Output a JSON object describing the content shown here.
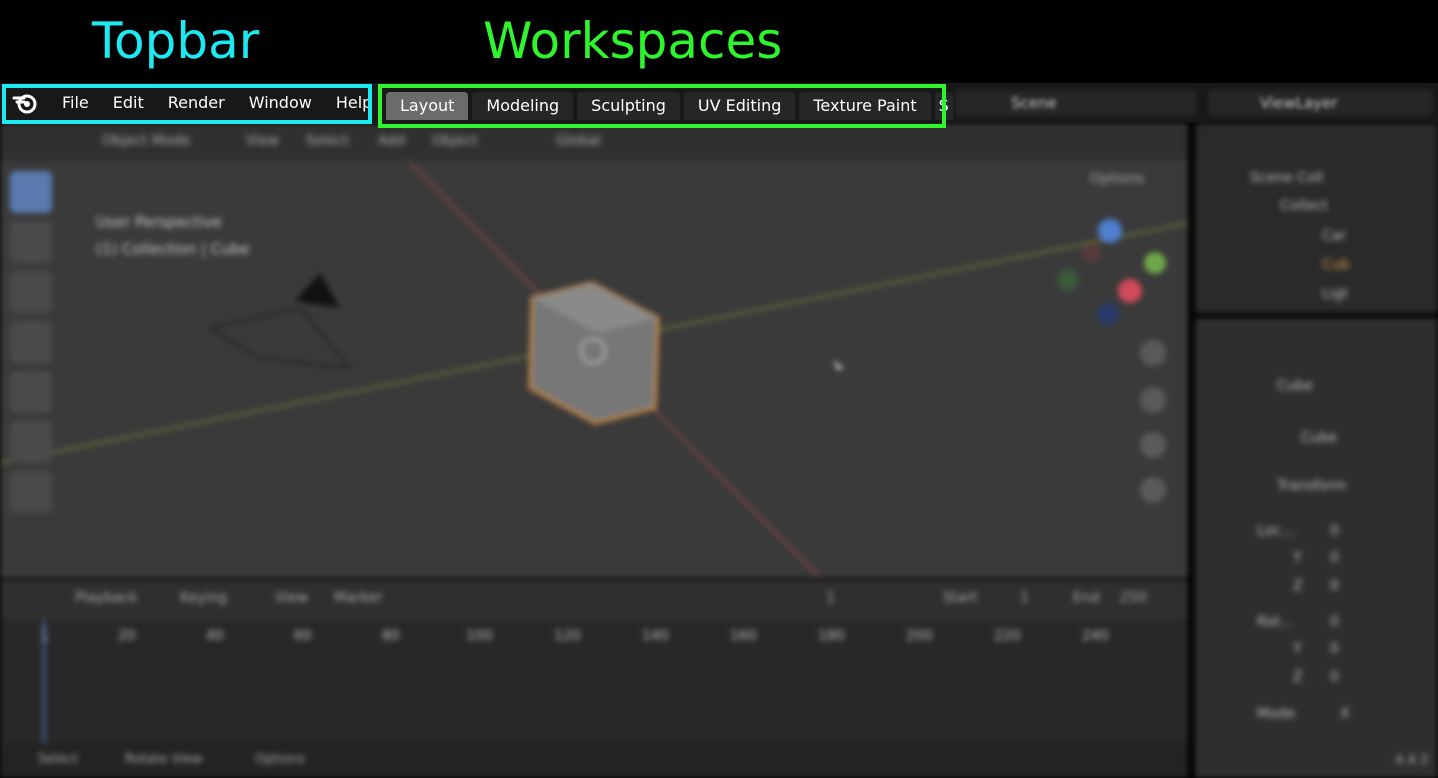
{
  "annotations": {
    "topbar_label": "Topbar",
    "workspaces_label": "Workspaces",
    "topbar_color": "#1de9f2",
    "workspaces_color": "#2ef52e"
  },
  "topbar": {
    "menu": [
      "File",
      "Edit",
      "Render",
      "Window",
      "Help"
    ],
    "workspace_tabs": [
      "Layout",
      "Modeling",
      "Sculpting",
      "UV Editing",
      "Texture Paint",
      "S"
    ],
    "active_tab": "Layout",
    "scene": "Scene",
    "view_layer": "ViewLayer"
  },
  "viewport_header": {
    "mode": "Object Mode",
    "menus": [
      "View",
      "Select",
      "Add",
      "Object"
    ],
    "orientation": "Global",
    "options": "Options"
  },
  "viewport": {
    "perspective": "User Perspective",
    "collection_info": "(1) Collection | Cube"
  },
  "outliner": {
    "items": [
      "Scene Coll",
      "Collect",
      "Car",
      "Cub",
      "Ligt"
    ]
  },
  "properties": {
    "object_name": "Cube",
    "mesh_name": "Cube",
    "panel": "Transform",
    "location_label": "Loc...",
    "rows": [
      "Y",
      "Z",
      "Rot...",
      "Y",
      "Z"
    ],
    "values": [
      "0",
      "0",
      "0",
      "0",
      "0",
      "0"
    ],
    "mode_label": "Mode",
    "mode_value": "X"
  },
  "timeline": {
    "menus": [
      "Playback",
      "Keying",
      "View",
      "Marker"
    ],
    "current_frame": "1",
    "start_label": "Start",
    "start": "1",
    "end_label": "End",
    "end": "250",
    "frame_numbers": [
      "1",
      "20",
      "40",
      "60",
      "80",
      "100",
      "120",
      "140",
      "160",
      "180",
      "200",
      "220",
      "240"
    ]
  },
  "statusbar": {
    "hints": [
      "Select",
      "Rotate View",
      "Options"
    ],
    "version": "4.4.3"
  }
}
